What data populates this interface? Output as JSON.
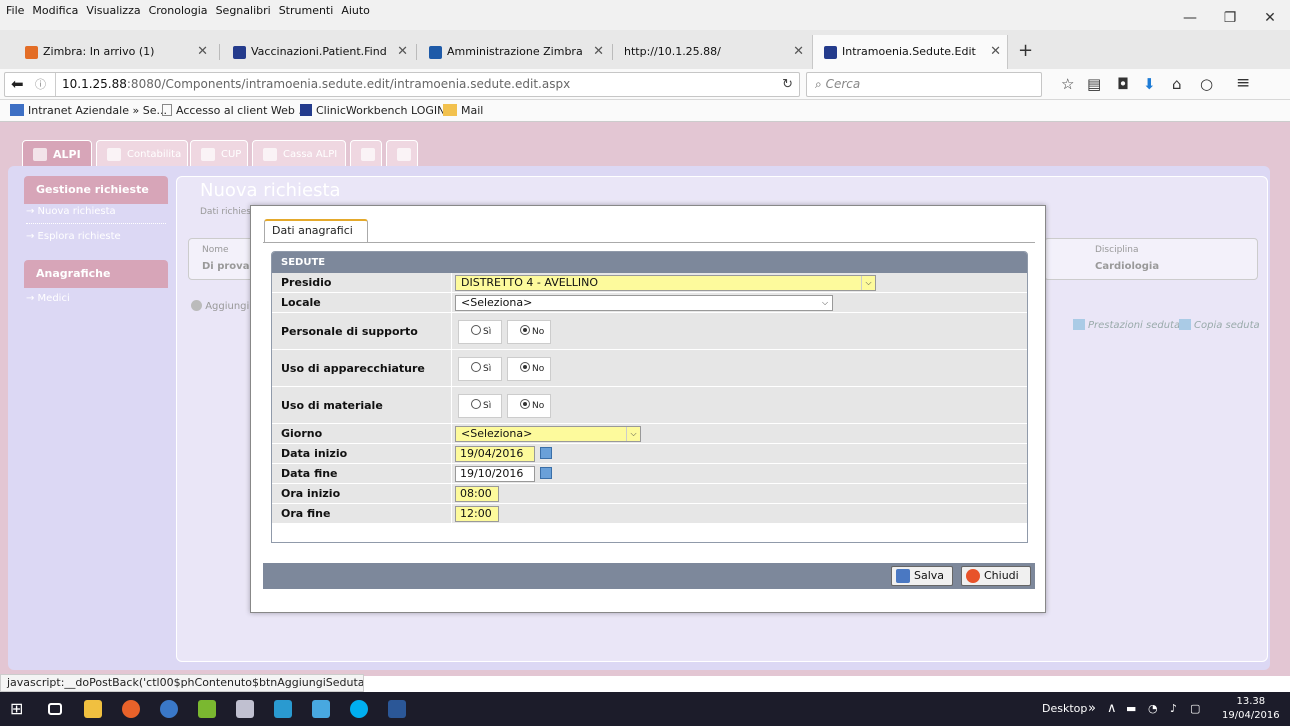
{
  "browser": {
    "menu": [
      "File",
      "Modifica",
      "Visualizza",
      "Cronologia",
      "Segnalibri",
      "Strumenti",
      "Aiuto"
    ],
    "tabs": [
      {
        "label": "Zimbra: In arrivo (1)",
        "icon": "zimbra-icon"
      },
      {
        "label": "Vaccinazioni.Patient.Find",
        "icon": "app-grid-icon"
      },
      {
        "label": "Amministrazione Zimbra",
        "icon": "zimbra-z-icon"
      },
      {
        "label": "http://10.1.25.88/",
        "icon": ""
      },
      {
        "label": "Intramoenia.Sedute.Edit",
        "icon": "app-grid-icon"
      }
    ],
    "url_host": "10.1.25.88",
    "url_rest": ":8080/Components/intramoenia.sedute.edit/intramoenia.sedute.edit.aspx",
    "search_placeholder": "Cerca",
    "bookmarks": [
      "Intranet Aziendale » Se...",
      "Accesso al client Web ...",
      "ClinicWorkbench LOGIN",
      "Mail"
    ],
    "status_text": "javascript:__doPostBack('ctl00$phContenuto$btnAggiungiSeduta','')"
  },
  "app": {
    "tabs": [
      {
        "label": "ALPI",
        "active": true
      },
      {
        "label": "Contabilita",
        "active": false
      },
      {
        "label": "CUP",
        "active": false
      },
      {
        "label": "Cassa ALPI",
        "active": false
      },
      {
        "label": "",
        "active": false
      },
      {
        "label": "",
        "active": false
      }
    ],
    "sidebar": {
      "section1": "Gestione richieste",
      "section1_items": [
        "→ Nuova richiesta",
        "→ Esplora richieste"
      ],
      "section2": "Anagrafiche",
      "section2_items": [
        "→ Medici"
      ]
    },
    "title": "Nuova richiesta",
    "subtitle": "Dati richiesta",
    "info": {
      "nome_label": "Nome",
      "nome_value": "Di prova",
      "disciplina_label": "Disciplina",
      "disciplina_value": "Cardiologia"
    },
    "add_link": "Aggiungi S",
    "prestazioni_link": "Prestazioni seduta",
    "copia_link": "Copia seduta"
  },
  "modal": {
    "tab_label": "Dati anagrafici",
    "section_title": "SEDUTE",
    "fields": {
      "presidio": {
        "label": "Presidio",
        "value": "DISTRETTO 4 - AVELLINO"
      },
      "locale": {
        "label": "Locale",
        "value": "<Seleziona>"
      },
      "personale": {
        "label": "Personale di supporto",
        "yes": "Sì",
        "no": "No",
        "selected": "No"
      },
      "apparecchiature": {
        "label": "Uso di apparecchiature",
        "yes": "Sì",
        "no": "No",
        "selected": "No"
      },
      "materiale": {
        "label": "Uso di materiale",
        "yes": "Sì",
        "no": "No",
        "selected": "No"
      },
      "giorno": {
        "label": "Giorno",
        "value": "<Seleziona>"
      },
      "data_inizio": {
        "label": "Data inizio",
        "value": "19/04/2016"
      },
      "data_fine": {
        "label": "Data fine",
        "value": "19/10/2016"
      },
      "ora_inizio": {
        "label": "Ora inizio",
        "value": "08:00"
      },
      "ora_fine": {
        "label": "Ora fine",
        "value": "12:00"
      }
    },
    "save_label": "Salva",
    "close_label": "Chiudi"
  },
  "taskbar": {
    "desktop_label": "Desktop",
    "time": "13.38",
    "date": "19/04/2016"
  },
  "colors": {
    "page_bg": "#e3c6d3",
    "tab_active": "#d7a5b8",
    "panel": "#dcd8f4",
    "section_header": "#7d889b",
    "field_yellow": "#fdfa9c"
  }
}
